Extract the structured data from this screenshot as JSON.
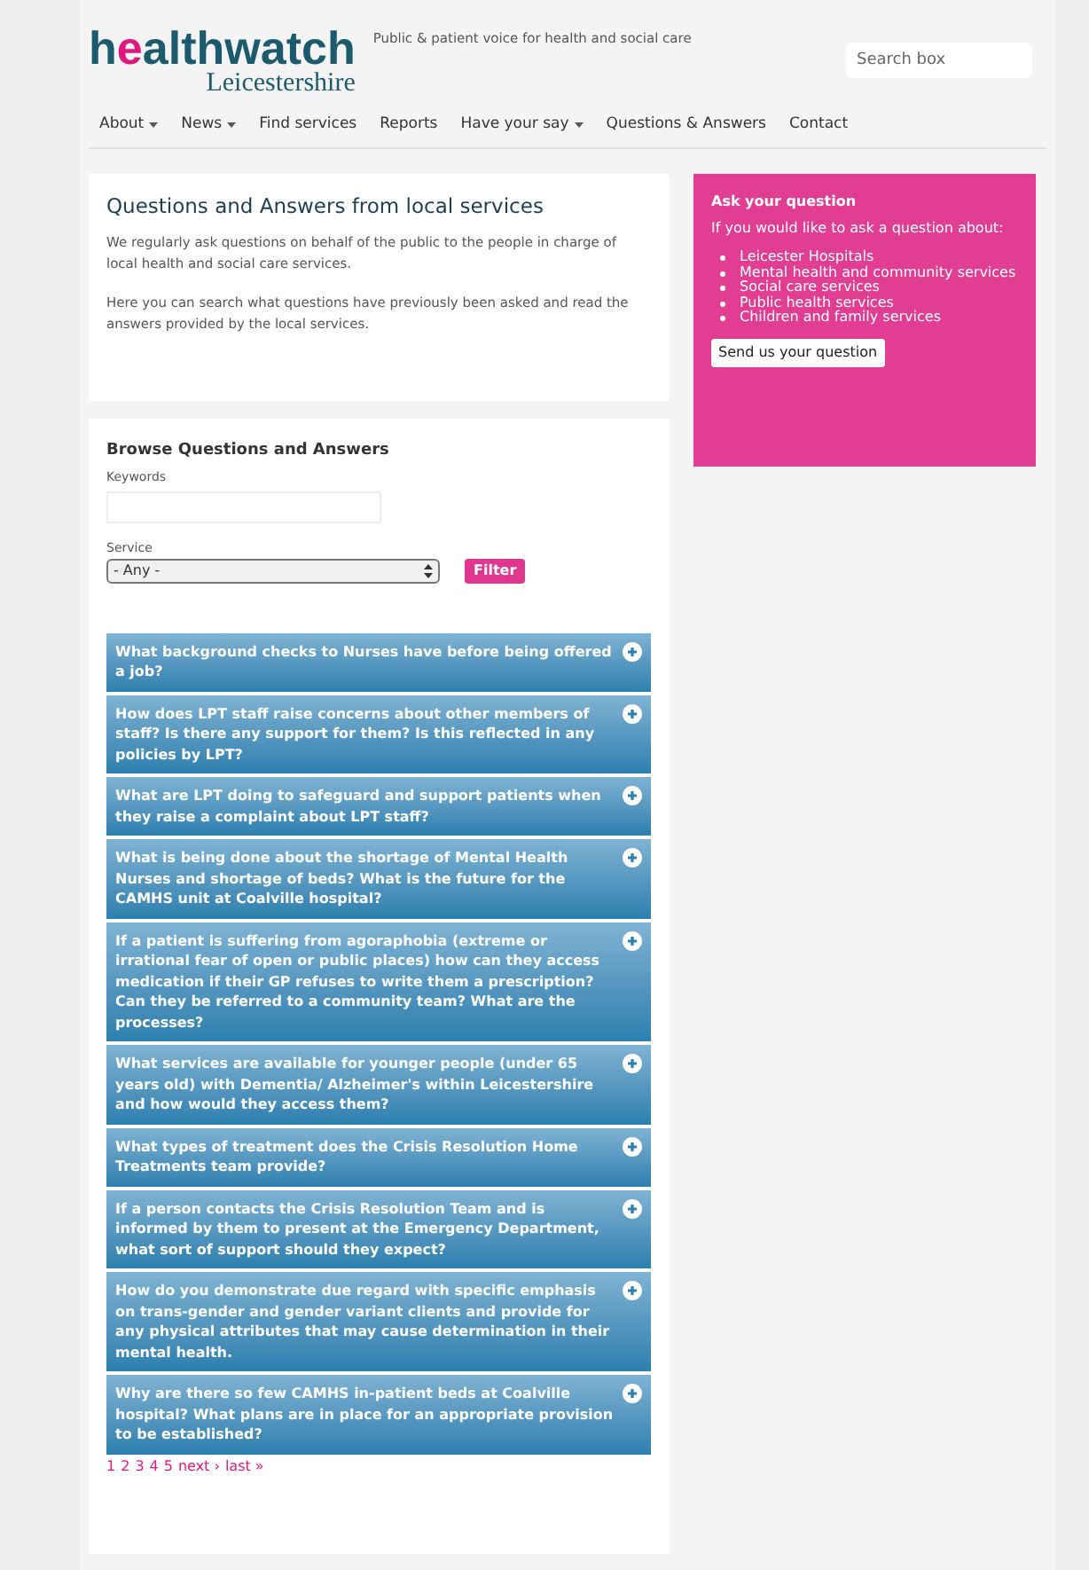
{
  "header": {
    "logo": "healthwatch",
    "logo_subtitle": "Leicestershire",
    "tagline": "Public & patient voice for health and social care",
    "search": {
      "placeholder": "Search box"
    }
  },
  "nav": [
    {
      "label": "About",
      "dropdown": true
    },
    {
      "label": "News",
      "dropdown": true
    },
    {
      "label": "Find services",
      "dropdown": false
    },
    {
      "label": "Reports",
      "dropdown": false
    },
    {
      "label": "Have your say",
      "dropdown": true
    },
    {
      "label": "Questions & Answers",
      "dropdown": false
    },
    {
      "label": "Contact",
      "dropdown": false
    }
  ],
  "intro": {
    "title": "Questions and Answers from local services",
    "paragraphs": [
      "We regularly ask questions on behalf of the public to the people in charge of local health and social care services.",
      "Here you can search what questions have previously been asked and read the answers provided by the local services."
    ]
  },
  "browse": {
    "title": "Browse Questions and Answers",
    "keywords_label": "Keywords",
    "service_label": "Service",
    "service_value": "- Any -",
    "filter_button": "Filter",
    "questions": [
      {
        "text": "What background checks to Nurses have before being offered a job?",
        "expanded": false
      },
      {
        "text": "How does LPT staff raise concerns about other members of staff? Is there any support for them? Is this reflected in any policies by LPT?",
        "expanded": false
      },
      {
        "text": "What are LPT doing to safeguard and support patients when they raise a complaint about LPT staff?",
        "expanded": false
      },
      {
        "text": "What is being done about the shortage of Mental Health Nurses and shortage of beds? What is the future for the CAMHS unit at Coalville hospital?",
        "expanded": false
      },
      {
        "text": "If a patient is suffering from agoraphobia (extreme or irrational fear of open or public places) how can they access medication if their GP refuses to write them a prescription? Can they be referred to a community team? What are the processes?",
        "expanded": false
      },
      {
        "text": "What services are available for younger people (under 65 years old) with Dementia/ Alzheimer's within Leicestershire and how would they access them?",
        "expanded": false
      },
      {
        "text": "What types of treatment does the Crisis Resolution Home Treatments team provide?",
        "expanded": false
      },
      {
        "text": "If a person contacts the Crisis Resolution Team and is informed by them to present at the Emergency Department, what sort of support should they expect?",
        "expanded": false
      },
      {
        "text": "How do you demonstrate due regard with specific emphasis on trans-gender and gender variant clients and provide for any physical attributes that may cause determination in their mental health.",
        "expanded": false
      },
      {
        "text": "Why are there so few CAMHS in-patient beds at Coalville hospital? What plans are in place for an appropriate provision to be established?",
        "expanded": false
      }
    ],
    "pager": [
      "1",
      "2",
      "3",
      "4",
      "5",
      "next ›",
      "last »"
    ]
  },
  "sidebar": {
    "title": "Ask your question",
    "intro": "If you would like to ask a question about:",
    "items": [
      "Leicester Hospitals",
      "Mental health and community services",
      "Social care services",
      "Public health services",
      "Children and family services"
    ],
    "button": "Send us your question"
  }
}
